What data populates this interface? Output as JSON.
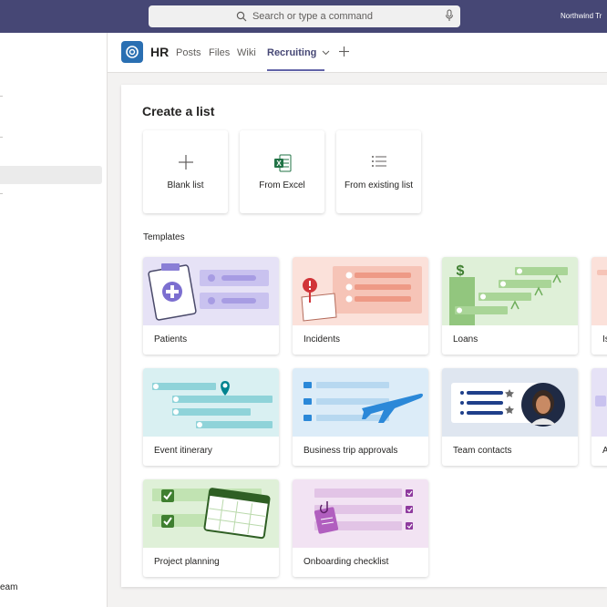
{
  "search": {
    "placeholder": "Search or type a command"
  },
  "org_name": "Northwind Tr",
  "left_panel": {
    "footer_text": "eam"
  },
  "header": {
    "team_name": "HR",
    "tabs": [
      {
        "label": "Posts"
      },
      {
        "label": "Files"
      },
      {
        "label": "Wiki"
      },
      {
        "label": "Recruiting"
      }
    ]
  },
  "create": {
    "title": "Create a list",
    "options": [
      {
        "label": "Blank list",
        "icon": "plus-icon"
      },
      {
        "label": "From Excel",
        "icon": "excel-icon"
      },
      {
        "label": "From existing list",
        "icon": "list-icon"
      }
    ]
  },
  "templates": {
    "heading": "Templates",
    "items": [
      {
        "label": "Patients",
        "color": "#e6e2f6"
      },
      {
        "label": "Incidents",
        "color": "#fbe1da"
      },
      {
        "label": "Loans",
        "color": "#dff0d8"
      },
      {
        "label": "Is",
        "color": "#fbe1da"
      },
      {
        "label": "Event itinerary",
        "color": "#d9f0f2"
      },
      {
        "label": "Business trip approvals",
        "color": "#dcecf8"
      },
      {
        "label": "Team contacts",
        "color": "#dfe6f0"
      },
      {
        "label": "A",
        "color": "#e6e2f6"
      },
      {
        "label": "Project planning",
        "color": "#dff0d8"
      },
      {
        "label": "Onboarding checklist",
        "color": "#f2e3f3"
      }
    ]
  },
  "colors": {
    "topbar": "#464775",
    "accent": "#6264a7",
    "team_logo": "#2a6fb2"
  }
}
